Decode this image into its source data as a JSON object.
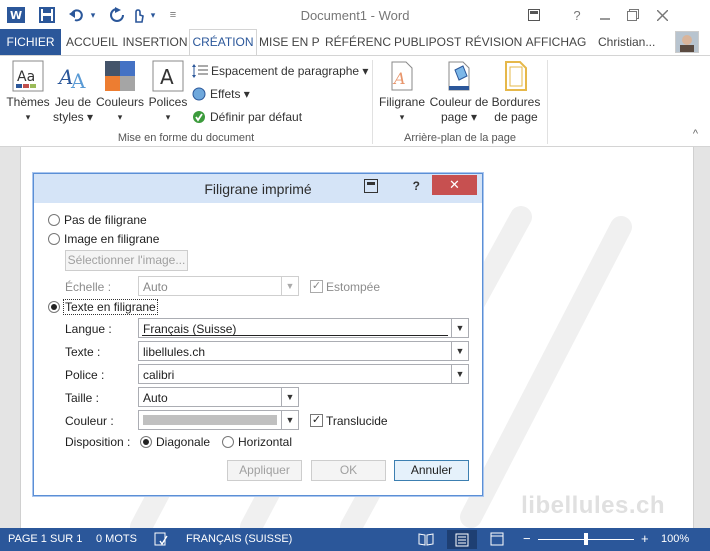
{
  "window": {
    "title": "Document1 - Word",
    "help": "?",
    "user": "Christian..."
  },
  "tabs": [
    {
      "label": "FICHIER"
    },
    {
      "label": "ACCUEIL"
    },
    {
      "label": "INSERTION"
    },
    {
      "label": "CRÉATION"
    },
    {
      "label": "MISE EN P"
    },
    {
      "label": "RÉFÉRENC"
    },
    {
      "label": "PUBLIPOST"
    },
    {
      "label": "RÉVISION"
    },
    {
      "label": "AFFICHAG"
    }
  ],
  "ribbon": {
    "themes": {
      "line1": "Thèmes",
      "line2": "▾"
    },
    "jeu_de_styles": {
      "line1": "Jeu de",
      "line2": "styles ▾"
    },
    "couleurs": {
      "line1": "Couleurs",
      "line2": "▾"
    },
    "polices": {
      "line1": "Polices",
      "line2": "▾"
    },
    "espacement": "Espacement de paragraphe ▾",
    "effets": "Effets ▾",
    "defaut": "Définir par défaut",
    "group1": "Mise en forme du document",
    "filigrane": {
      "line1": "Filigrane",
      "line2": "▾"
    },
    "couleur_page": {
      "line1": "Couleur de",
      "line2": "page ▾"
    },
    "bordures": {
      "line1": "Bordures",
      "line2": "de page"
    },
    "group2": "Arrière-plan de la page",
    "collapse": "^"
  },
  "watermark_text": "libellules.ch",
  "dialog": {
    "title": "Filigrane imprimé",
    "help": "?",
    "close": "✕",
    "no_watermark": "Pas de filigrane",
    "picture_watermark": "Image en filigrane",
    "select_image": "Sélectionner l'image...",
    "scale_label": "Échelle :",
    "scale_value": "Auto",
    "washout_label": "Estompée",
    "text_watermark": "Texte en filigrane",
    "language_label": "Langue :",
    "language_value": "Français (Suisse)",
    "text_label": "Texte :",
    "text_value": "libellules.ch",
    "font_label": "Police :",
    "font_value": "calibri",
    "size_label": "Taille :",
    "size_value": "Auto",
    "color_label": "Couleur :",
    "semitransparent_label": "Translucide",
    "layout_label": "Disposition :",
    "diagonal_label": "Diagonale",
    "horizontal_label": "Horizontal",
    "apply_button": "Appliquer",
    "ok_button": "OK",
    "cancel_button": "Annuler",
    "selected_mode": "text",
    "layout_selected": "diagonal",
    "washout_checked": true,
    "semitransparent_checked": true
  },
  "status": {
    "page": "PAGE 1 SUR 1",
    "words": "0 MOTS",
    "language": "FRANÇAIS (SUISSE)",
    "zoom": "100%",
    "zoom_out": "−",
    "zoom_in": "+"
  },
  "colors": {
    "accent": "#2b579a",
    "dialog_title_bg": "#d5e4f7",
    "close_red": "#c75050"
  }
}
